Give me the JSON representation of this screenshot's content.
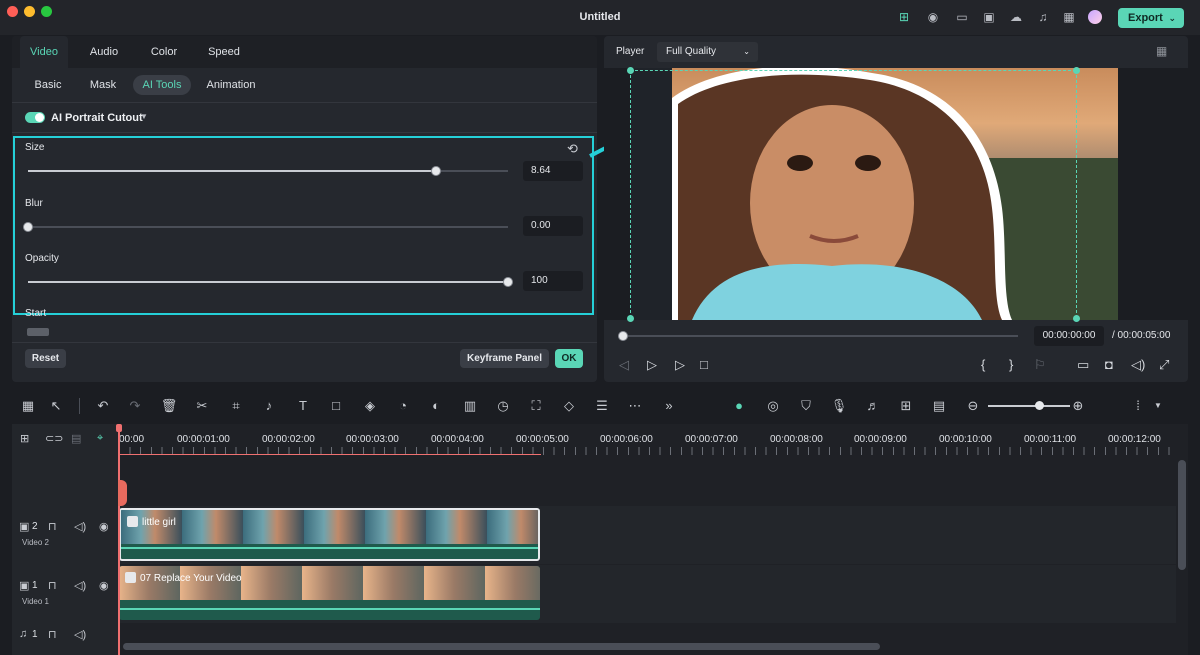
{
  "window": {
    "title": "Untitled"
  },
  "header": {
    "export_label": "Export"
  },
  "left_panel": {
    "tabs": [
      {
        "label": "Video",
        "active": true
      },
      {
        "label": "Audio",
        "active": false
      },
      {
        "label": "Color",
        "active": false
      },
      {
        "label": "Speed",
        "active": false
      }
    ],
    "subtabs": [
      {
        "label": "Basic",
        "active": false
      },
      {
        "label": "Mask",
        "active": false
      },
      {
        "label": "AI Tools",
        "active": true
      },
      {
        "label": "Animation",
        "active": false
      }
    ],
    "feature": {
      "label": "AI Portrait Cutout",
      "enabled": true
    },
    "params": [
      {
        "label": "Size",
        "value": "8.64",
        "level": 0.85
      },
      {
        "label": "Blur",
        "value": "0.00",
        "level": 0.0
      },
      {
        "label": "Opacity",
        "value": "100",
        "level": 1.0
      }
    ],
    "start_label": "Start",
    "reset_label": "Reset",
    "keyframe_label": "Keyframe Panel",
    "ok_label": "OK"
  },
  "player": {
    "label": "Player",
    "quality": "Full Quality",
    "current_time": "00:00:00:00",
    "total_time": "/ 00:00:05:00",
    "progress": 0.0
  },
  "timeline": {
    "ruler": [
      "00:00",
      "00:00:01:00",
      "00:00:02:00",
      "00:00:03:00",
      "00:00:04:00",
      "00:00:05:00",
      "00:00:06:00",
      "00:00:07:00",
      "00:00:08:00",
      "00:00:09:00",
      "00:00:10:00",
      "00:00:11:00",
      "00:00:12:00"
    ],
    "tracks": [
      {
        "num": "2",
        "name": "Video 2",
        "clip": "little girl"
      },
      {
        "num": "1",
        "name": "Video 1",
        "clip": "07 Replace Your Video"
      },
      {
        "num": "1",
        "name": "",
        "clip": ""
      }
    ]
  },
  "colors": {
    "accent": "#5ad6b6",
    "highlight": "#25d0d8",
    "playhead": "#f07070"
  }
}
